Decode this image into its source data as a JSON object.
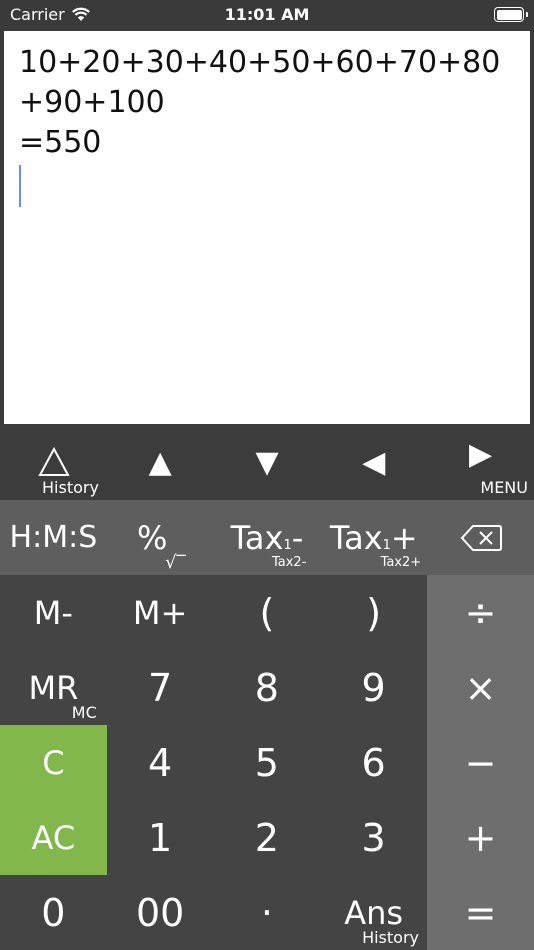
{
  "status_bar": {
    "carrier": "Carrier",
    "time": "11:01 AM"
  },
  "display": {
    "expression": "10+20+30+40+50+60+70+80+90+100",
    "result": "=550"
  },
  "nav": {
    "history_sub": "History",
    "up": "▲",
    "down": "▼",
    "left": "◀",
    "right": "▶",
    "menu_sub": "MENU"
  },
  "functions": {
    "hms": "H:M:S",
    "percent": "%",
    "sqrt": "√‾",
    "tax_minus_main": "Tax",
    "tax_minus_sup": "1",
    "tax_minus_sign": "-",
    "tax_minus_sub": "Tax2-",
    "tax_plus_main": "Tax",
    "tax_plus_sup": "1",
    "tax_plus_sign": "+",
    "tax_plus_sub": "Tax2+"
  },
  "keys": {
    "m_minus": "M-",
    "m_plus": "M+",
    "paren_open": "(",
    "paren_close": ")",
    "mr": "MR",
    "mc": "MC",
    "seven": "7",
    "eight": "8",
    "nine": "9",
    "clear": "C",
    "four": "4",
    "five": "5",
    "six": "6",
    "all_clear": "AC",
    "one": "1",
    "two": "2",
    "three": "3",
    "zero": "0",
    "double_zero": "00",
    "decimal": "·",
    "ans": "Ans",
    "ans_history": "History"
  },
  "operators": {
    "divide": "÷",
    "multiply": "×",
    "subtract": "−",
    "add": "+",
    "equals": "="
  }
}
